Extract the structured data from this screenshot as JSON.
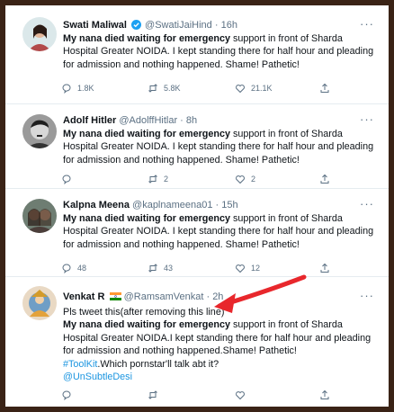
{
  "tweets": [
    {
      "name": "Swati Maliwal",
      "handle": "@SwatiJaiHind",
      "time": "· 16h",
      "verified": true,
      "bold": "My nana died waiting for emergency",
      "text": " support in front of Sharda Hospital Greater NOIDA. I kept standing there for half hour and pleading for admission and nothing happened. Shame! Pathetic!",
      "replies": "1.8K",
      "retweets": "5.8K",
      "likes": "21.1K"
    },
    {
      "name": "Adolf Hitler",
      "handle": "@AdolffHitlar",
      "time": "· 8h",
      "bold": "My nana died waiting for emergency",
      "text": " support in front of Sharda Hospital Greater NOIDA. I kept standing there for half hour and pleading for admission and nothing happened. Shame! Pathetic!",
      "replies": "",
      "retweets": "2",
      "likes": "2"
    },
    {
      "name": "Kalpna Meena",
      "handle": "@kaplnameena01",
      "time": "· 15h",
      "bold": "My nana died waiting for emergency",
      "text": " support in front of Sharda Hospital Greater NOIDA. I kept standing there for half hour and pleading for admission and nothing happened. Shame! Pathetic!",
      "replies": "48",
      "retweets": "43",
      "likes": "12"
    },
    {
      "name": "Venkat R",
      "handle": "@RamsamVenkat",
      "time": "· 2h",
      "intro": "Pls tweet this(after removing this line)",
      "bold": "My nana died waiting for emergency",
      "text": " support in front of Sharda Hospital Greater NOIDA.I kept standing there for half hour and pleading for admission and nothing happened.Shame! Pathetic!",
      "hashtag": "#ToolKit",
      "after_hashtag": ".Which pornstar'll talk abt it?",
      "mention": "@UnSubtleDesi",
      "replies": "",
      "retweets": "",
      "likes": ""
    }
  ],
  "more_label": "···",
  "colors": {
    "link": "#1b95e0",
    "arrow": "#e8272c",
    "muted": "#5b7083"
  }
}
